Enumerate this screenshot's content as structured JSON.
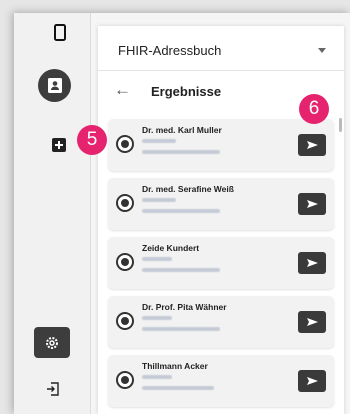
{
  "app": {
    "accent": "#e6236f",
    "dark_button": "#3a3a3a"
  },
  "rail": {
    "items": [
      {
        "icon": "phone-icon"
      },
      {
        "icon": "address-book-icon"
      },
      {
        "icon": "add-icon"
      },
      {
        "icon": "settings-gear-icon"
      },
      {
        "icon": "logout-icon"
      }
    ]
  },
  "panel": {
    "dropdown_label": "FHIR-Adressbuch",
    "back_icon": "back-arrow-icon",
    "back_glyph": "←",
    "results_title": "Ergebnisse"
  },
  "results": [
    {
      "name": "Dr. med. Karl Muller"
    },
    {
      "name": "Dr. med. Serafine Weiß"
    },
    {
      "name": "Zeide Kundert"
    },
    {
      "name": "Dr. Prof. Pita Wähner"
    },
    {
      "name": "Thillmann Acker"
    }
  ],
  "markers": {
    "left": "5",
    "right": "6"
  }
}
